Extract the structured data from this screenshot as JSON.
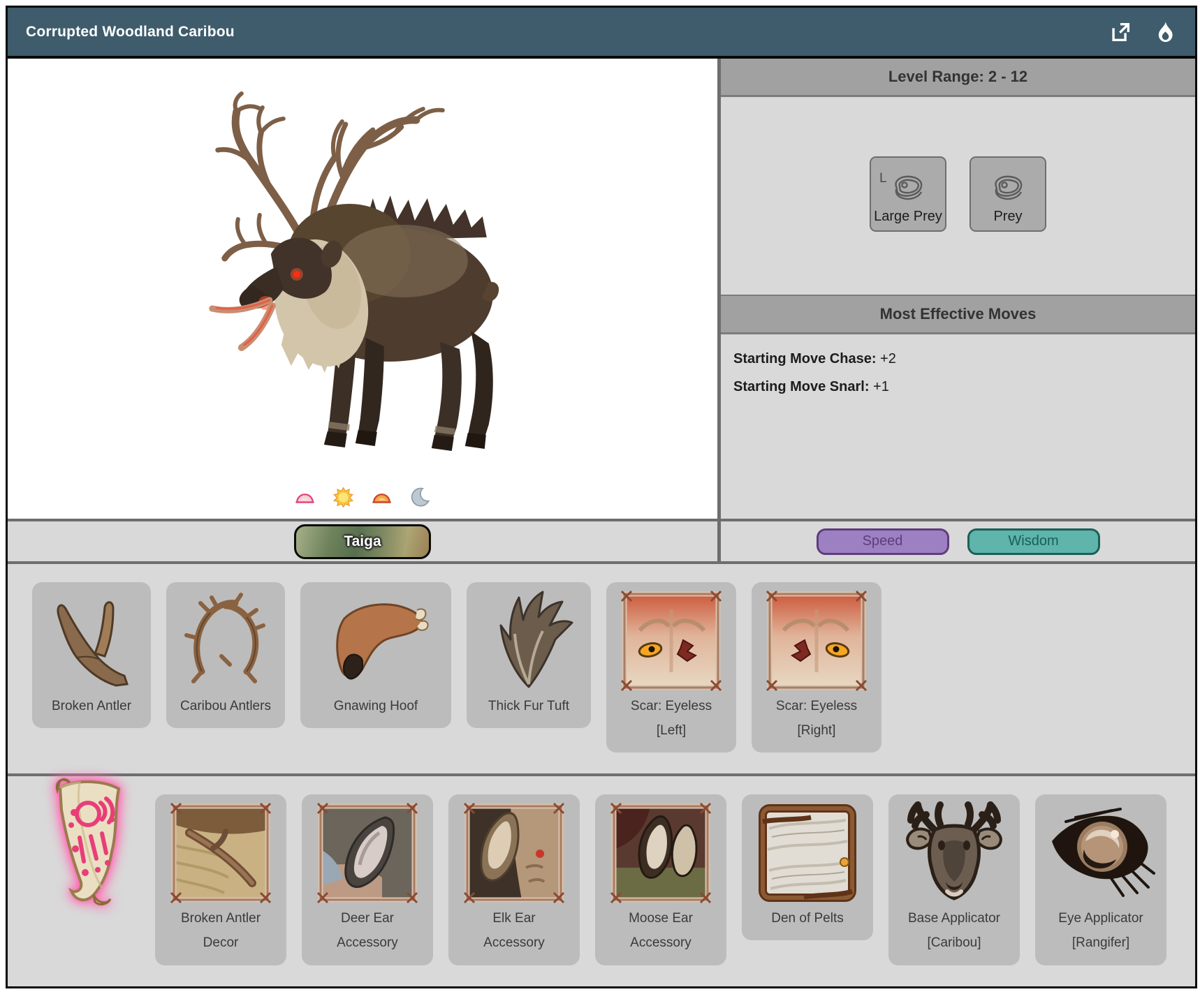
{
  "header": {
    "title": "Corrupted Woodland Caribou",
    "icons": [
      "external-link",
      "flame"
    ]
  },
  "creature": {
    "name": "Corrupted Woodland Caribou",
    "active_times": [
      "sunrise",
      "day",
      "sunset",
      "night"
    ],
    "biome": {
      "label": "Taiga"
    }
  },
  "stats": {
    "level_range_title": "Level Range: 2 - 12",
    "prey": [
      {
        "label": "Large Prey",
        "badge": "L",
        "icon": "steak-icon"
      },
      {
        "label": "Prey",
        "badge": "",
        "icon": "steak-icon"
      }
    ],
    "moves_title": "Most Effective Moves",
    "moves": [
      {
        "label": "Starting Move Chase:",
        "value": "+2"
      },
      {
        "label": "Starting Move Snarl:",
        "value": "+1"
      }
    ],
    "stat_buttons": [
      {
        "label": "Speed",
        "fill": "#9d80c1",
        "border": "#5e3d7d",
        "text": "#5e3d7d"
      },
      {
        "label": "Wisdom",
        "fill": "#5fb4ab",
        "border": "#1c6058",
        "text": "#15605a"
      }
    ]
  },
  "drops": {
    "items": [
      {
        "label": "Broken Antler"
      },
      {
        "label": "Caribou Antlers"
      },
      {
        "label": "Gnawing Hoof"
      },
      {
        "label": "Thick Fur Tuft"
      },
      {
        "label": "Scar: Eyeless [Left]"
      },
      {
        "label": "Scar: Eyeless [Right]"
      }
    ]
  },
  "special_drops": {
    "scroll_icon": "recipe-scroll",
    "items": [
      {
        "label": "Broken Antler Decor"
      },
      {
        "label": "Deer Ear Accessory"
      },
      {
        "label": "Elk Ear Accessory"
      },
      {
        "label": "Moose Ear Accessory"
      },
      {
        "label": "Den of Pelts"
      },
      {
        "label": "Base Applicator [Caribou]"
      },
      {
        "label": "Eye Applicator [Rangifer]"
      }
    ]
  },
  "colors": {
    "titlebar": "#3e5c6b",
    "band": "#a1a1a1",
    "panel": "#d9d9d9",
    "card": "#bcbcbc"
  }
}
